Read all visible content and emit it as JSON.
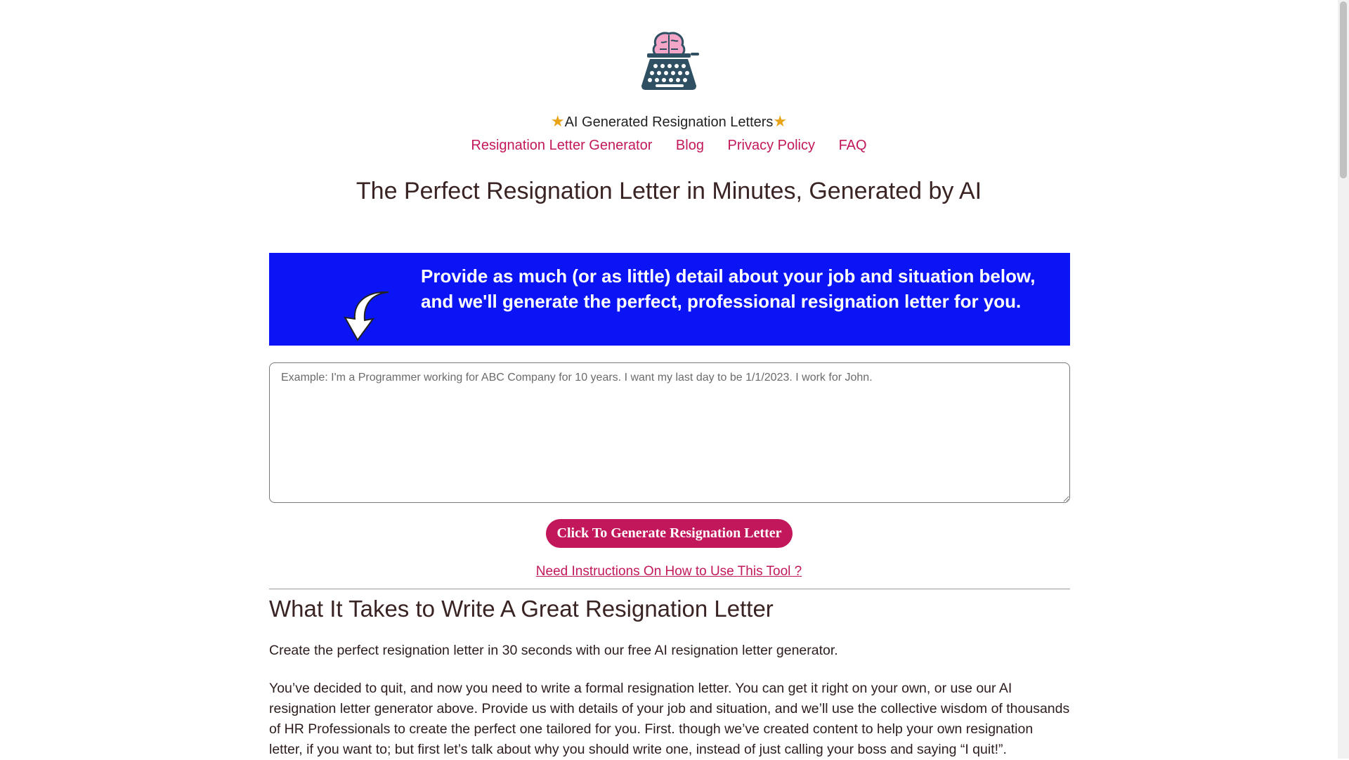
{
  "header": {
    "logo_name": "brain-typewriter-logo",
    "site_title": "AI Generated Resignation Letters",
    "star_glyph": "★"
  },
  "nav": {
    "items": [
      {
        "label": "Resignation Letter Generator"
      },
      {
        "label": "Blog"
      },
      {
        "label": "Privacy Policy"
      },
      {
        "label": "FAQ"
      }
    ]
  },
  "hero": {
    "title": "The Perfect Resignation Letter in Minutes, Generated by AI"
  },
  "banner": {
    "text": "Provide as much (or as little) detail about your job and situation below, and we'll generate the perfect, professional resignation letter for you.",
    "bg_color": "#0a14f5",
    "icon": "curved-arrow-down-left-icon"
  },
  "form": {
    "placeholder": "Example: I'm a Programmer working for ABC Company for 10 years. I want my last day to be 1/1/2023. I work for John.",
    "value": "",
    "button_label": "Click To Generate Resignation Letter",
    "instructions_link": "Need Instructions On How to Use This Tool ?"
  },
  "article": {
    "heading": "What It Takes to Write A Great Resignation Letter",
    "paragraph1": "Create the perfect resignation letter in 30 seconds with our free AI resignation letter generator.",
    "paragraph2": "You’ve decided to quit, and now you need to write a formal resignation letter. You can get it right on your own, or use our AI resignation letter generator above. Provide us with details of your job and situation, and we’ll use the collective wisdom of thousands of HR Professionals to create the perfect one tailored for you. First. though we’ve created content to help your own resignation letter, if you want to; but first let’s talk about why you should write one, instead of just calling your boss and saying “I quit!”."
  },
  "colors": {
    "accent": "#c2185b",
    "banner": "#0a14f5",
    "star": "#e8a317",
    "logo_dark": "#2f4f63",
    "logo_pink": "#f4a6c8"
  }
}
